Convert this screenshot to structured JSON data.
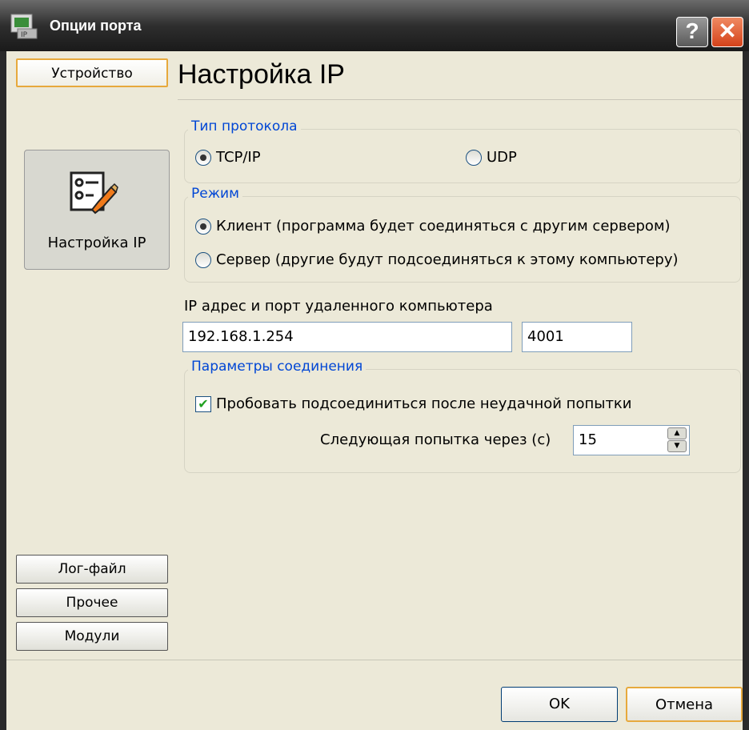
{
  "window": {
    "title": "Опции порта",
    "help_glyph": "?",
    "close_glyph": "✕"
  },
  "sidebar": {
    "top_button": "Устройство",
    "panel_item": {
      "label": "Настройка IP",
      "icon": "network-settings-icon"
    },
    "bottom_buttons": [
      "Лог-файл",
      "Прочее",
      "Модули"
    ]
  },
  "main": {
    "title": "Настройка IP",
    "protocol": {
      "title": "Тип протокола",
      "options": [
        "TCP/IP",
        "UDP"
      ],
      "selected": "TCP/IP"
    },
    "mode": {
      "title": "Режим",
      "options": [
        "Клиент (программа будет соединяться с другим сервером)",
        "Сервер (другие будут подсоединяться к этому компьютеру)"
      ],
      "selected": "Клиент (программа будет соединяться с другим сервером)"
    },
    "address": {
      "label": "IP адрес и порт удаленного компьютера",
      "ip": "192.168.1.254",
      "port": "4001"
    },
    "connection": {
      "title": "Параметры соединения",
      "retry_label": "Пробовать подсоединиться после неудачной попытки",
      "retry_checked": true,
      "next_attempt_label": "Следующая попытка через (с)",
      "next_attempt_value": "15"
    }
  },
  "footer": {
    "ok_label": "OK",
    "cancel_label": "Отмена"
  },
  "colors": {
    "accent": "#0046d5",
    "focus_border": "#e7a93c",
    "title_bar": "#2e2e2e",
    "close": "#d4421a",
    "radio_on": "#21a121"
  }
}
